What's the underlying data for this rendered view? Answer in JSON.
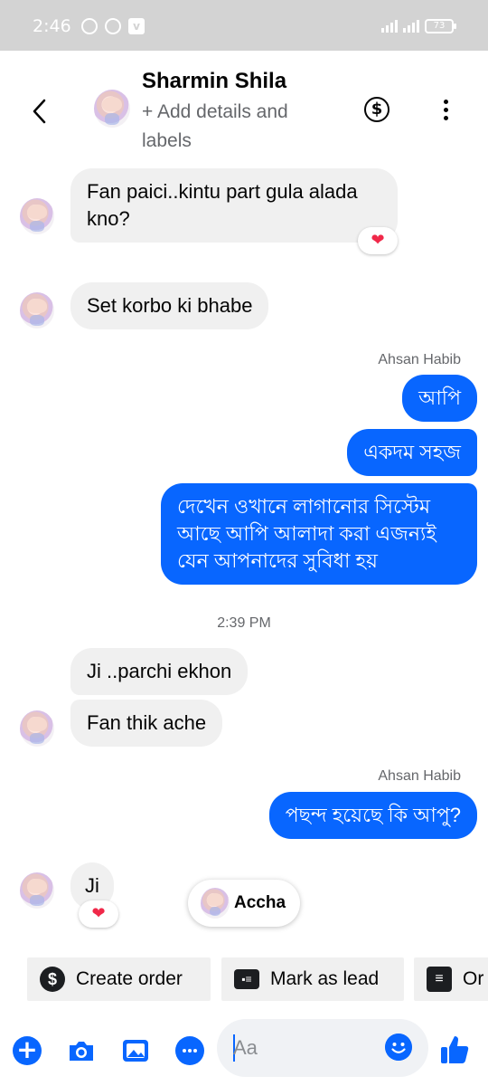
{
  "status": {
    "time": "2:46",
    "battery": "73"
  },
  "header": {
    "name": "Sharmin Shila",
    "subtitle": "+ Add details and labels",
    "dollar_symbol": "$"
  },
  "messages": [
    {
      "side": "in",
      "text": "Fan paici..kintu part gula alada kno?",
      "reaction": "❤"
    },
    {
      "side": "in",
      "text": "Set korbo ki bhabe"
    },
    {
      "side": "out_sender",
      "text": "Ahsan Habib"
    },
    {
      "side": "out",
      "text": "আপি"
    },
    {
      "side": "out",
      "text": "একদম সহজ"
    },
    {
      "side": "out",
      "text": "দেখেন ওখানে লাগানোর সিস্টেম আছে আপি আলাদা করা এজন্যই যেন আপনাদের সুবিধা হয়"
    },
    {
      "side": "time",
      "text": "2:39 PM"
    },
    {
      "side": "in",
      "text": "Ji ..parchi ekhon"
    },
    {
      "side": "in",
      "text": "Fan thik ache"
    },
    {
      "side": "out_sender",
      "text": "Ahsan Habib"
    },
    {
      "side": "out",
      "text": "পছন্দ হয়েছে কি আপু?"
    },
    {
      "side": "in",
      "text": "Ji",
      "reaction": "❤"
    }
  ],
  "toast": {
    "text": "Accha"
  },
  "chips": [
    {
      "label": "Create order",
      "icon": "dollar-circle-icon"
    },
    {
      "label": "Mark as lead",
      "icon": "contact-card-icon"
    },
    {
      "label": "Or",
      "icon": "list-icon"
    }
  ],
  "composer": {
    "placeholder": "Aa"
  },
  "colors": {
    "accent": "#0866ff",
    "incoming": "#f0f0f0",
    "heart": "#f02849"
  }
}
